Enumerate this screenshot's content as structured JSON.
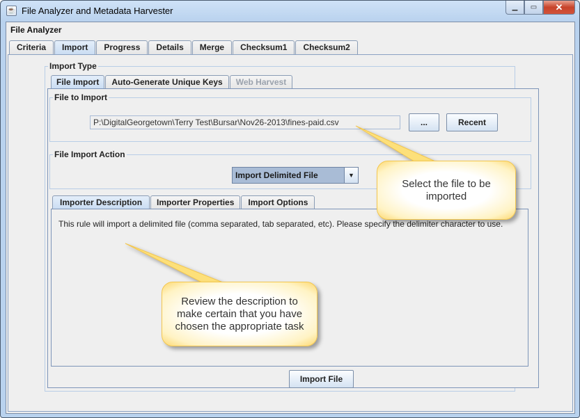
{
  "window": {
    "title": "File Analyzer and Metadata Harvester",
    "controls": {
      "minimize": "minimize-icon",
      "maximize": "maximize-icon",
      "close": "close-icon"
    }
  },
  "app": {
    "heading": "File Analyzer",
    "main_tabs": [
      {
        "label": "Criteria",
        "active": false
      },
      {
        "label": "Import",
        "active": true
      },
      {
        "label": "Progress",
        "active": false
      },
      {
        "label": "Details",
        "active": false
      },
      {
        "label": "Merge",
        "active": false
      },
      {
        "label": "Checksum1",
        "active": false
      },
      {
        "label": "Checksum2",
        "active": false
      }
    ]
  },
  "import_type": {
    "label": "Import Type",
    "tabs": [
      {
        "label": "File Import",
        "active": true,
        "enabled": true
      },
      {
        "label": "Auto-Generate Unique Keys",
        "active": false,
        "enabled": true
      },
      {
        "label": "Web Harvest",
        "active": false,
        "enabled": false
      }
    ]
  },
  "file_to_import": {
    "label": "File to Import",
    "path": "P:\\DigitalGeorgetown\\Terry Test\\Bursar\\Nov26-2013\\fines-paid.csv",
    "browse_label": "...",
    "recent_label": "Recent"
  },
  "file_import_action": {
    "label": "File Import Action",
    "selected": "Import Delimited File"
  },
  "importer_tabs": [
    {
      "label": "Importer Description",
      "active": true
    },
    {
      "label": "Importer Properties",
      "active": false
    },
    {
      "label": "Import Options",
      "active": false
    }
  ],
  "importer_description": "This rule will import a delimited file (comma separated, tab separated, etc).  Please specify the delimiter character to use.",
  "import_button": "Import File",
  "callouts": {
    "select_file": "Select the file to be imported",
    "review_description": "Review the description to make certain that you have chosen the appropriate task"
  },
  "colors": {
    "accent": "#c9dcf2",
    "callout_border": "#f3c750",
    "combo_fill": "#a9bcd6"
  }
}
